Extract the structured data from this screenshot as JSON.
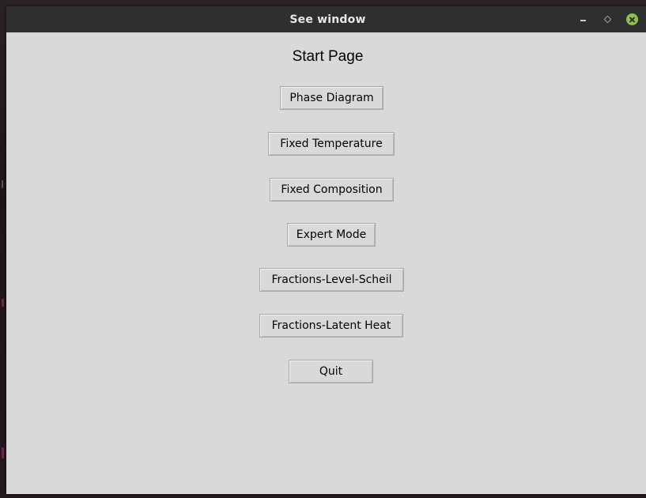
{
  "window": {
    "title": "See window"
  },
  "page": {
    "title": "Start Page"
  },
  "buttons": {
    "phase_diagram": "Phase Diagram",
    "fixed_temperature": "Fixed Temperature",
    "fixed_composition": "Fixed Composition",
    "expert_mode": "Expert Mode",
    "fractions_level_scheil": "Fractions-Level-Scheil",
    "fractions_latent_heat": "Fractions-Latent Heat",
    "quit": "Quit"
  },
  "icons": {
    "minimize": "minimize-icon",
    "maximize": "maximize-icon",
    "close": "close-icon"
  },
  "colors": {
    "titlebar": "#2f2f2f",
    "window_bg": "#d9d9d9",
    "close_button": "#8bc34a"
  }
}
